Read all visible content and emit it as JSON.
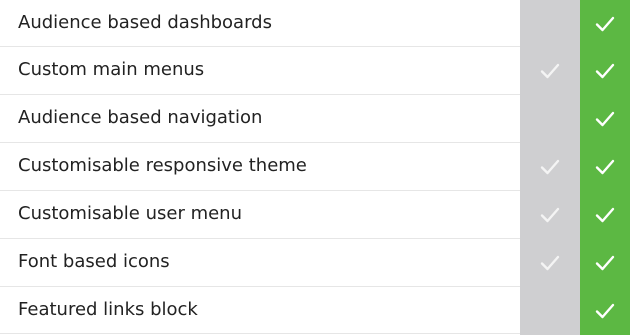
{
  "colors": {
    "basic_column": "#cfcfd1",
    "premium_column": "#5cb843",
    "check_on_basic": "#f4f4f4",
    "check_on_premium": "#ffffff",
    "text": "#222222",
    "divider": "#e6e6e6"
  },
  "features": [
    {
      "label": "Audience based dashboards",
      "basic": false,
      "premium": true
    },
    {
      "label": "Custom main menus",
      "basic": true,
      "premium": true
    },
    {
      "label": "Audience based navigation",
      "basic": false,
      "premium": true
    },
    {
      "label": "Customisable responsive theme",
      "basic": true,
      "premium": true
    },
    {
      "label": "Customisable user menu",
      "basic": true,
      "premium": true
    },
    {
      "label": "Font based icons",
      "basic": true,
      "premium": true
    },
    {
      "label": "Featured links block",
      "basic": false,
      "premium": true
    }
  ],
  "icons": {
    "included": "checkmark-icon"
  }
}
